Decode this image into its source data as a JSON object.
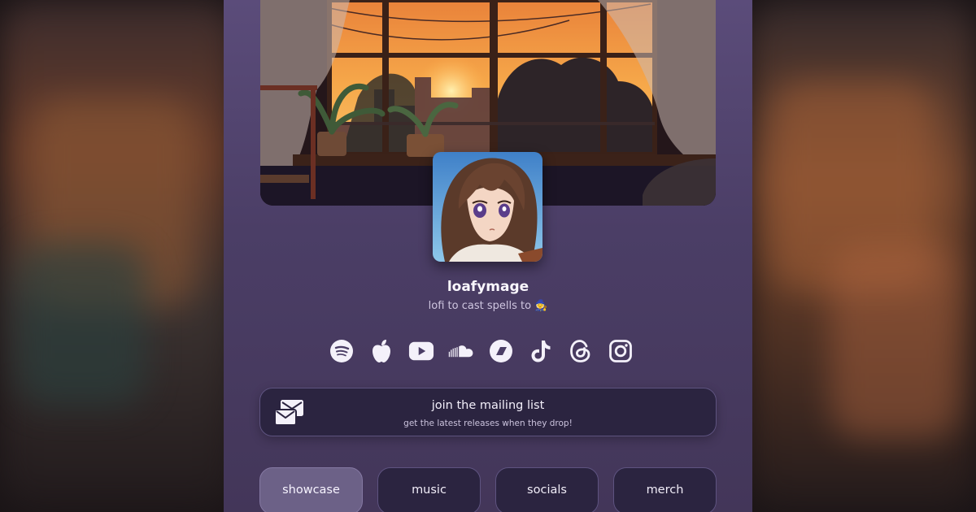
{
  "profile": {
    "name": "loafymage",
    "tagline": "lofi to cast spells to 🧙",
    "avatar_alt": "anime girl avatar"
  },
  "socials": [
    {
      "name": "spotify-icon",
      "label": "Spotify"
    },
    {
      "name": "apple-icon",
      "label": "Apple Music"
    },
    {
      "name": "youtube-icon",
      "label": "YouTube"
    },
    {
      "name": "soundcloud-icon",
      "label": "SoundCloud"
    },
    {
      "name": "bandcamp-icon",
      "label": "Bandcamp"
    },
    {
      "name": "tiktok-icon",
      "label": "TikTok"
    },
    {
      "name": "threads-icon",
      "label": "Threads"
    },
    {
      "name": "instagram-icon",
      "label": "Instagram"
    }
  ],
  "mailing": {
    "title": "join the mailing list",
    "subtitle": "get the latest releases when they drop!"
  },
  "tabs": [
    {
      "label": "showcase",
      "active": true
    },
    {
      "label": "music",
      "active": false
    },
    {
      "label": "socials",
      "active": false
    },
    {
      "label": "merch",
      "active": false
    }
  ],
  "colors": {
    "card_bg": "#4b3e66",
    "button_bg": "#2b2440",
    "button_border": "#5e5380",
    "active_tab": "#6c6187",
    "sunset": "#f0973e"
  }
}
